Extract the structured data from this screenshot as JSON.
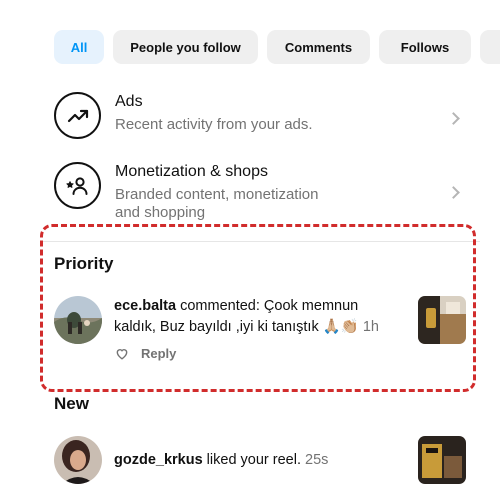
{
  "filters": [
    {
      "label": "All",
      "active": true
    },
    {
      "label": "People you follow",
      "active": false
    },
    {
      "label": "Comments",
      "active": false
    },
    {
      "label": "Follows",
      "active": false
    }
  ],
  "menu": {
    "ads": {
      "title": "Ads",
      "subtitle": "Recent activity from your ads.",
      "icon": "trend-up-icon"
    },
    "monetization": {
      "title": "Monetization & shops",
      "subtitle_line1": "Branded content, monetization",
      "subtitle_line2": "and shopping",
      "icon": "person-star-icon"
    }
  },
  "priority": {
    "title": "Priority",
    "notification": {
      "username": "ece.balta",
      "text_line1": " commented: Çook memnun",
      "text_line2": "kaldık, Buz bayıldı ,iyi ki tanıştık 🙏🏼👏🏼 ",
      "time": "1h",
      "reply_label": "Reply"
    }
  },
  "new": {
    "title": "New",
    "notification": {
      "username": "gozde_krkus",
      "text": " liked your reel. ",
      "time": "25s"
    }
  },
  "colors": {
    "accent": "#0095f6",
    "chip_active_bg": "#e6f2fd",
    "highlight": "#d12c2c"
  }
}
